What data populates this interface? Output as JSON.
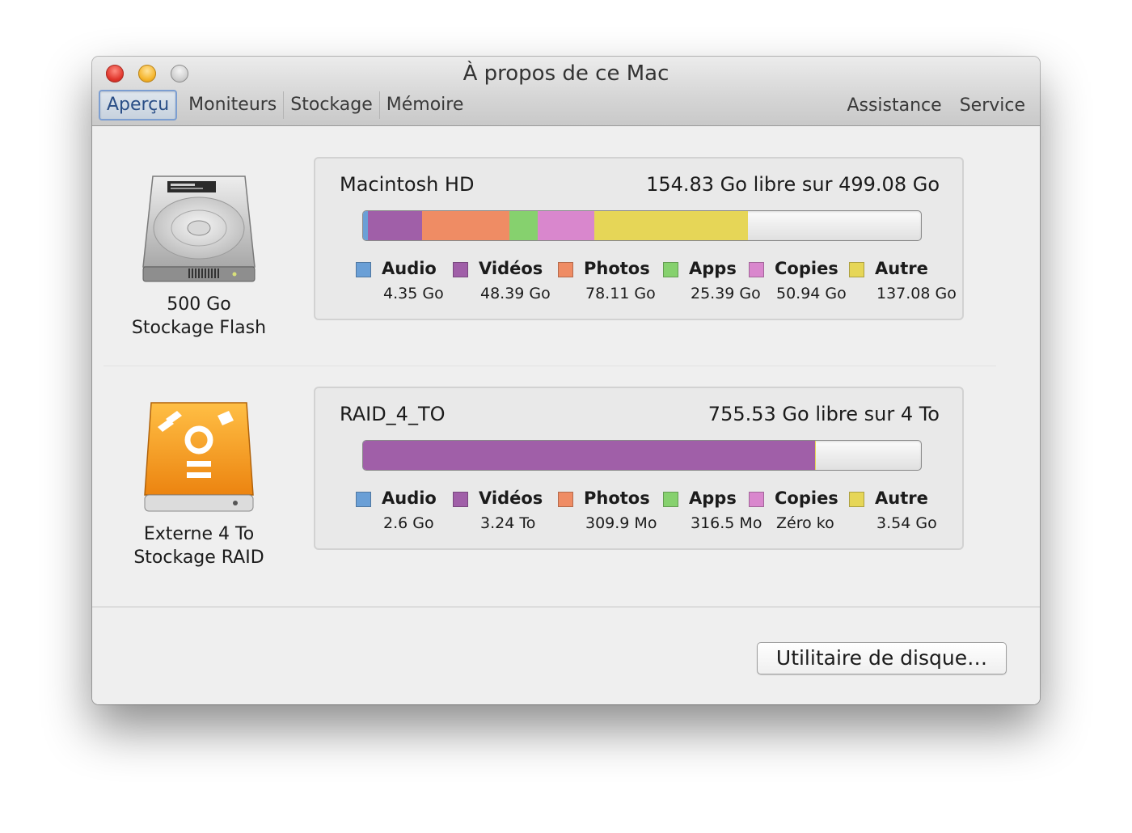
{
  "window": {
    "title": "À propos de ce Mac"
  },
  "tabs": [
    {
      "label": "Aperçu"
    },
    {
      "label": "Moniteurs"
    },
    {
      "label": "Stockage"
    },
    {
      "label": "Mémoire"
    }
  ],
  "links": {
    "assistance": "Assistance",
    "service": "Service"
  },
  "colors": {
    "audio": "#6a9fd6",
    "videos": "#a05fa8",
    "photos": "#ef8c64",
    "apps": "#86d16e",
    "copies": "#d987cd",
    "autre": "#e6d657"
  },
  "drives": [
    {
      "icon": "hard-disk-icon",
      "caption_line1": "500 Go",
      "caption_line2": "Stockage Flash",
      "name": "Macintosh HD",
      "free": "154.83 Go libre sur 499.08 Go",
      "legend": [
        {
          "key": "audio",
          "label": "Audio",
          "value": "4.35 Go"
        },
        {
          "key": "videos",
          "label": "Vidéos",
          "value": "48.39 Go"
        },
        {
          "key": "photos",
          "label": "Photos",
          "value": "78.11 Go"
        },
        {
          "key": "apps",
          "label": "Apps",
          "value": "25.39 Go"
        },
        {
          "key": "copies",
          "label": "Copies",
          "value": "50.94 Go"
        },
        {
          "key": "autre",
          "label": "Autre",
          "value": "137.08 Go"
        }
      ],
      "usage_fractions": [
        0.0087,
        0.097,
        0.1565,
        0.0509,
        0.1021,
        0.2747
      ]
    },
    {
      "icon": "firewire-drive-icon",
      "caption_line1": "Externe 4 To",
      "caption_line2": "Stockage RAID",
      "name": "RAID_4_TO",
      "free": "755.53 Go libre sur 4 To",
      "legend": [
        {
          "key": "audio",
          "label": "Audio",
          "value": "2.6 Go"
        },
        {
          "key": "videos",
          "label": "Vidéos",
          "value": "3.24 To"
        },
        {
          "key": "photos",
          "label": "Photos",
          "value": "309.9 Mo"
        },
        {
          "key": "apps",
          "label": "Apps",
          "value": "316.5 Mo"
        },
        {
          "key": "copies",
          "label": "Copies",
          "value": "Zéro ko"
        },
        {
          "key": "autre",
          "label": "Autre",
          "value": "3.54 Go"
        }
      ],
      "usage_fractions": [
        0.0007,
        0.81,
        0.0001,
        0.0001,
        0,
        0.0009
      ]
    }
  ],
  "footer": {
    "disk_utility_label": "Utilitaire de disque…"
  }
}
